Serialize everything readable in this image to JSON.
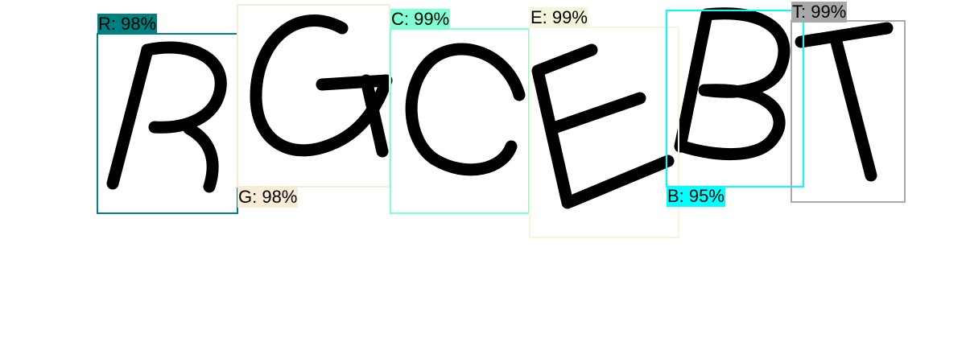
{
  "detections": [
    {
      "char": "R",
      "confidence": "98%",
      "label": "R: 98%",
      "color": "#008080"
    },
    {
      "char": "G",
      "confidence": "98%",
      "label": "G: 98%",
      "color": "#FAEBD7"
    },
    {
      "char": "C",
      "confidence": "99%",
      "label": "C: 99%",
      "color": "#7FFFD4"
    },
    {
      "char": "E",
      "confidence": "99%",
      "label": "E: 99%",
      "color": "#F5F5DC"
    },
    {
      "char": "B",
      "confidence": "95%",
      "label": "B: 95%",
      "color": "#00FFFF"
    },
    {
      "char": "T",
      "confidence": "99%",
      "label": "T: 99%",
      "color": "#A9A9A9"
    }
  ]
}
